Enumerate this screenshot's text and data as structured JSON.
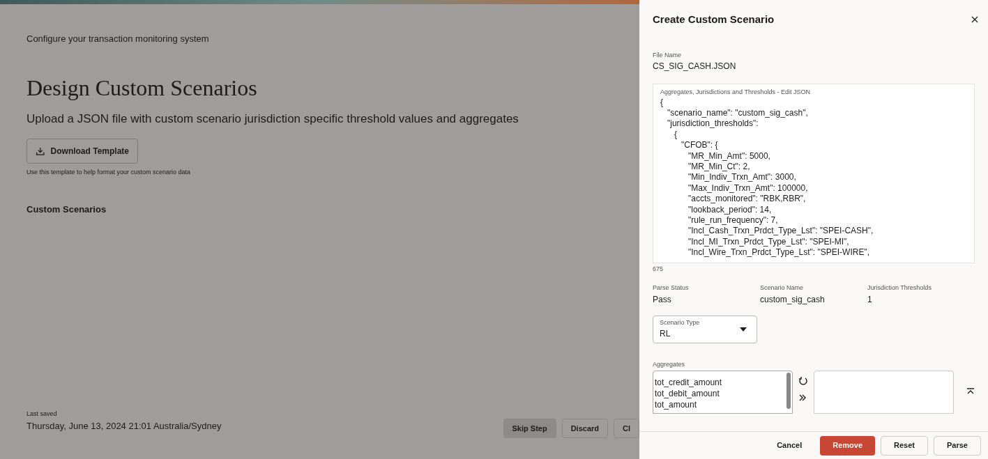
{
  "page": {
    "subtitle": "Configure your transaction monitoring system",
    "title": "Design Custom Scenarios",
    "description": "Upload a JSON file with custom scenario jurisdiction specific threshold values and aggregates",
    "download_button": "Download Template",
    "download_hint": "Use this template to help format your custom scenario data",
    "section_heading": "Custom Scenarios",
    "last_saved_label": "Last saved",
    "last_saved_value": "Thursday, June 13, 2024 21:01 Australia/Sydney",
    "footer_buttons": [
      {
        "label": "Skip Step",
        "kind": "filled"
      },
      {
        "label": "Discard",
        "kind": "outline"
      },
      {
        "label": "Cl",
        "kind": "outline"
      }
    ]
  },
  "panel": {
    "title": "Create Custom Scenario",
    "file_name_label": "File Name",
    "file_name": "CS_SIG_CASH.JSON",
    "editor": {
      "label": "Aggregates, Jurisdictions and Thresholds - Edit JSON",
      "value": "{\n   \"scenario_name\": \"custom_sig_cash\",\n   \"jurisdiction_thresholds\":\n      {\n         \"CFOB\": {\n            \"MR_Min_Amt\": 5000,\n            \"MR_Min_Ct\": 2,\n            \"Min_Indiv_Trxn_Amt\": 3000,\n            \"Max_Indiv_Trxn_Amt\": 100000,\n            \"accts_monitored\": \"RBK,RBR\",\n            \"lookback_period\": 14,\n            \"rule_run_frequency\": 7,\n            \"Incl_Cash_Trxn_Prdct_Type_Lst\": \"SPEI-CASH\",\n            \"Incl_MI_Trxn_Prdct_Type_Lst\": \"SPEI-MI\",\n            \"Incl_Wire_Trxn_Prdct_Type_Lst\": \"SPEI-WIRE\","
    },
    "char_count": "675",
    "summary": [
      {
        "label": "Parse Status",
        "value": "Pass"
      },
      {
        "label": "Scenario Name",
        "value": "custom_sig_cash"
      },
      {
        "label": "Jurisdiction Thresholds",
        "value": "1"
      }
    ],
    "scenario_type": {
      "label": "Scenario Type",
      "value": "RL"
    },
    "aggregates": {
      "label": "Aggregates",
      "available": [
        "tot_credit_amount",
        "tot_debit_amount",
        "tot_amount"
      ]
    },
    "buttons": [
      {
        "label": "Cancel",
        "kind": "text"
      },
      {
        "label": "Remove",
        "kind": "danger"
      },
      {
        "label": "Reset",
        "kind": "outline"
      },
      {
        "label": "Parse",
        "kind": "outline"
      }
    ]
  }
}
